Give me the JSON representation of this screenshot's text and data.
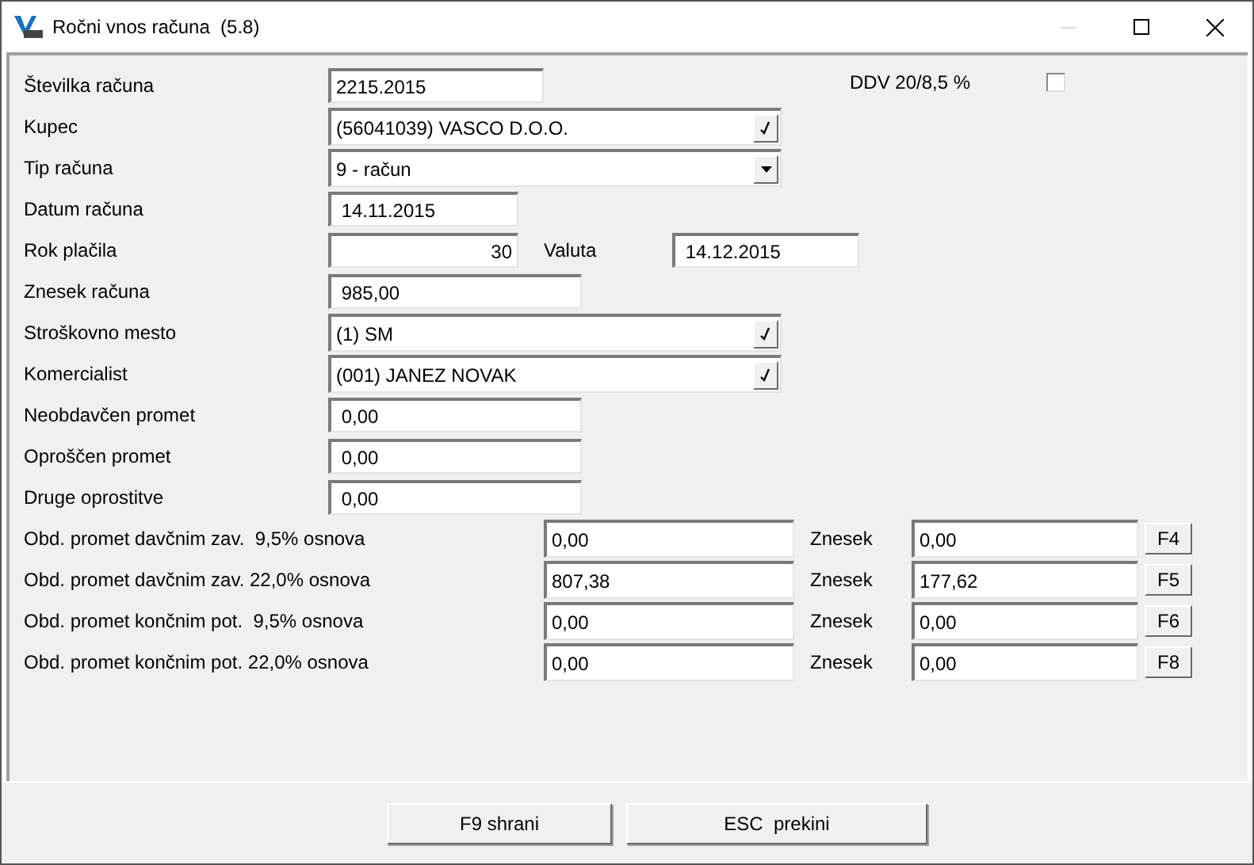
{
  "window": {
    "title": "Ročni vnos računa  (5.8)"
  },
  "vat_option": {
    "label": "DDV 20/8,5 %",
    "checked": false
  },
  "fields": [
    {
      "kind": "text",
      "label": "Številka računa",
      "value": "2215.2015"
    },
    {
      "kind": "lookup",
      "label": "Kupec",
      "value": "(56041039) VASCO D.O.O."
    },
    {
      "kind": "select",
      "label": "Tip računa",
      "value": "9 - račun"
    },
    {
      "kind": "text",
      "label": "Datum računa",
      "value": " 14.11.2015"
    },
    {
      "kind": "number",
      "label": "Rok plačila",
      "value": "30",
      "extra_label": "Valuta",
      "extra_value": " 14.12.2015"
    },
    {
      "kind": "text",
      "label": "Znesek računa",
      "value": " 985,00"
    },
    {
      "kind": "lookup",
      "label": "Stroškovno mesto",
      "value": "(1) SM"
    },
    {
      "kind": "lookup",
      "label": "Komercialist",
      "value": "(001) JANEZ NOVAK"
    },
    {
      "kind": "text",
      "label": "Neobdavčen promet",
      "value": " 0,00"
    },
    {
      "kind": "text",
      "label": "Oproščen promet",
      "value": " 0,00"
    },
    {
      "kind": "text",
      "label": "Druge oprostitve",
      "value": " 0,00"
    }
  ],
  "tax_rows": [
    {
      "label": "Obd. promet davčnim zav.  9,5% osnova",
      "base": "0,00",
      "amount_label": "Znesek",
      "amount": "0,00",
      "key": "F4"
    },
    {
      "label": "Obd. promet davčnim zav. 22,0% osnova",
      "base": "807,38",
      "amount_label": "Znesek",
      "amount": "177,62",
      "key": "F5"
    },
    {
      "label": "Obd. promet končnim pot.  9,5% osnova",
      "base": "0,00",
      "amount_label": "Znesek",
      "amount": "0,00",
      "key": "F6"
    },
    {
      "label": "Obd. promet končnim pot. 22,0% osnova",
      "base": "0,00",
      "amount_label": "Znesek",
      "amount": "0,00",
      "key": "F8"
    }
  ],
  "buttons": [
    {
      "label": "F9 shrani"
    },
    {
      "label": "ESC  prekini"
    }
  ]
}
